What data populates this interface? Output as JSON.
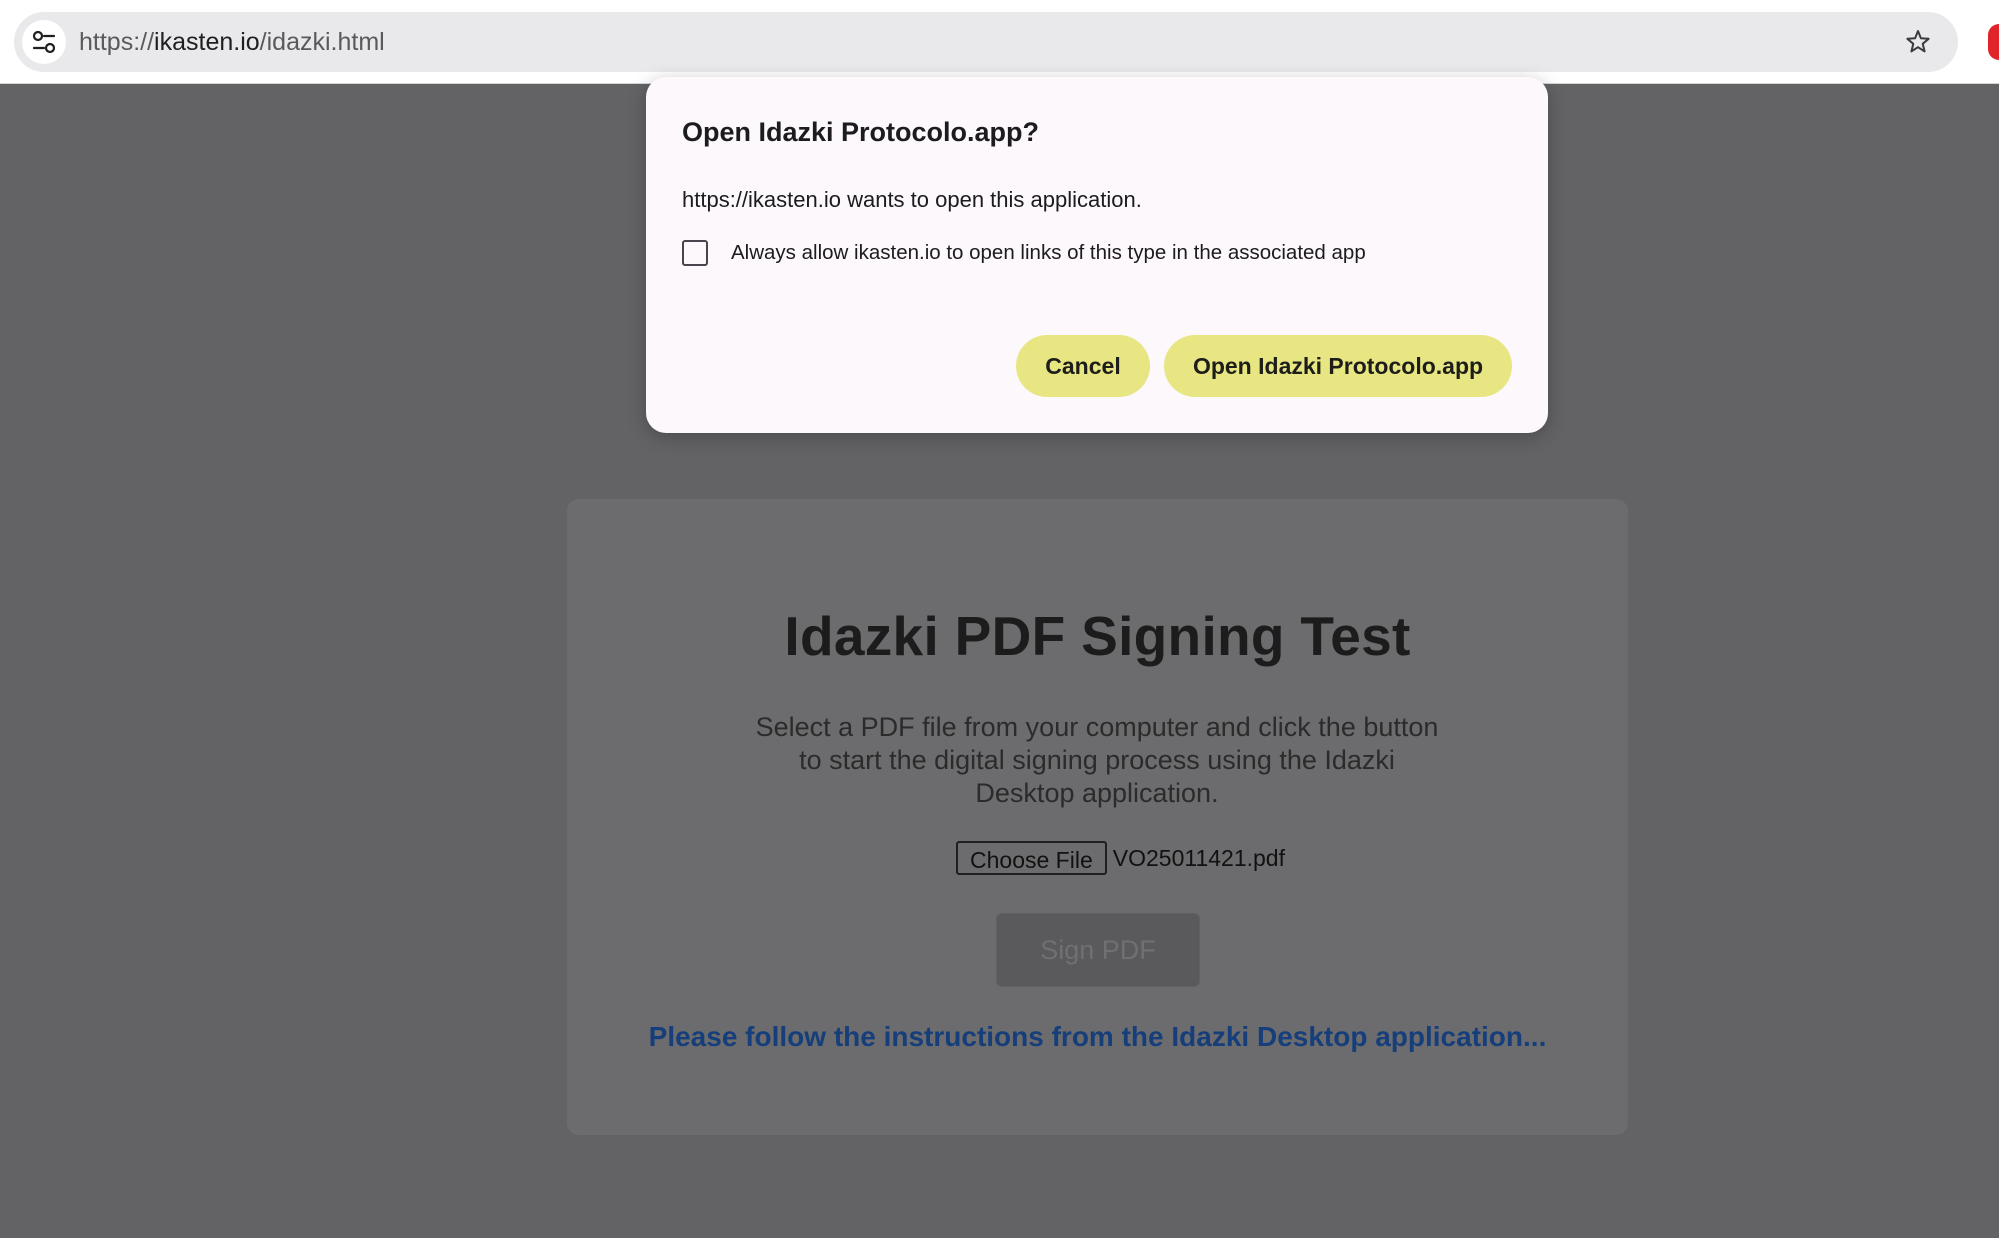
{
  "browser": {
    "url_scheme": "https://",
    "url_host": "ikasten.io",
    "url_path": "/idazki.html",
    "icons": {
      "site_info": "tune-icon",
      "bookmark": "star-icon",
      "extension": "extension-icon"
    }
  },
  "page": {
    "title": "Idazki PDF Signing Test",
    "description": "Select a PDF file from your computer and click the button to start the digital signing process using the Idazki Desktop application.",
    "choose_file_label": "Choose File",
    "file_name": "VO25011421.pdf",
    "sign_button": "Sign PDF",
    "status_message": "Please follow the instructions from the Idazki Desktop application..."
  },
  "dialog": {
    "title": "Open Idazki Protocolo.app?",
    "message": "https://ikasten.io wants to open this application.",
    "checkbox_label": "Always allow ikasten.io to open links of this type in the associated app",
    "checkbox_checked": false,
    "cancel_button": "Cancel",
    "open_button": "Open Idazki Protocolo.app"
  },
  "colors": {
    "overlay": "#636366",
    "dialog_bg": "#fcf8fb",
    "button_bg": "#e8e683",
    "status_text": "#153e7a"
  }
}
